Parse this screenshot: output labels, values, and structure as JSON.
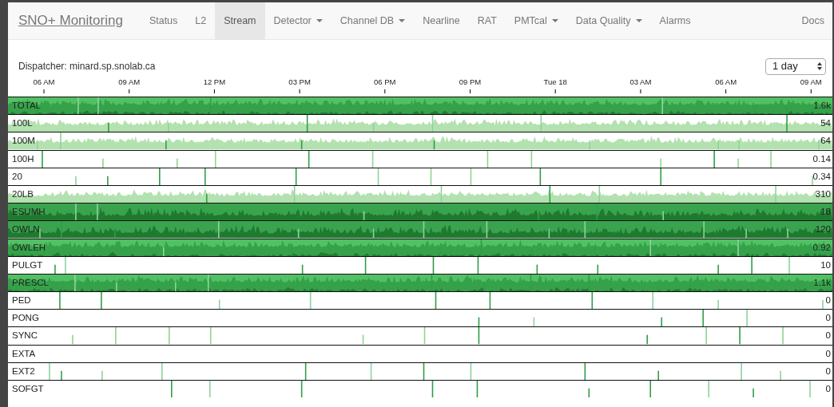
{
  "navbar": {
    "brand": "SNO+ Monitoring",
    "items": [
      {
        "label": "Status",
        "selected": false,
        "dropdown": false
      },
      {
        "label": "L2",
        "selected": false,
        "dropdown": false
      },
      {
        "label": "Stream",
        "selected": true,
        "dropdown": false
      },
      {
        "label": "Detector",
        "selected": false,
        "dropdown": true
      },
      {
        "label": "Channel DB",
        "selected": false,
        "dropdown": true
      },
      {
        "label": "Nearline",
        "selected": false,
        "dropdown": false
      },
      {
        "label": "RAT",
        "selected": false,
        "dropdown": false
      },
      {
        "label": "PMTcal",
        "selected": false,
        "dropdown": true
      },
      {
        "label": "Data Quality",
        "selected": false,
        "dropdown": true
      },
      {
        "label": "Alarms",
        "selected": false,
        "dropdown": false
      }
    ],
    "right_item": "Docs"
  },
  "dispatcher": "Dispatcher: minard.sp.snolab.ca",
  "range_select": {
    "value": "1 day"
  },
  "time_axis": {
    "ticks": [
      "06 AM",
      "09 AM",
      "12 PM",
      "03 PM",
      "06 PM",
      "09 PM",
      "Tue 18",
      "03 AM",
      "06 AM",
      "09 AM"
    ]
  },
  "streams": [
    {
      "name": "TOTAL",
      "value": "1.6k",
      "kind": "dense"
    },
    {
      "name": "100L",
      "value": "54",
      "kind": "light"
    },
    {
      "name": "100M",
      "value": "64",
      "kind": "light"
    },
    {
      "name": "100H",
      "value": "0.14",
      "kind": "spikes"
    },
    {
      "name": "20",
      "value": "0.34",
      "kind": "spikes"
    },
    {
      "name": "20LB",
      "value": "310",
      "kind": "light"
    },
    {
      "name": "ESUMH",
      "value": "18",
      "kind": "dark"
    },
    {
      "name": "OWLN",
      "value": "120",
      "kind": "dark"
    },
    {
      "name": "OWLEH",
      "value": "0.92",
      "kind": "dense"
    },
    {
      "name": "PULGT",
      "value": "10",
      "kind": "spikes"
    },
    {
      "name": "PRESCL",
      "value": "1.1k",
      "kind": "dense"
    },
    {
      "name": "PED",
      "value": "0",
      "kind": "spikes"
    },
    {
      "name": "PONG",
      "value": "0",
      "kind": "spikes"
    },
    {
      "name": "SYNC",
      "value": "0",
      "kind": "spikes"
    },
    {
      "name": "EXTA",
      "value": "0",
      "kind": "empty"
    },
    {
      "name": "EXT2",
      "value": "0",
      "kind": "spikes"
    },
    {
      "name": "SOFGT",
      "value": "0",
      "kind": "spikes"
    }
  ]
}
